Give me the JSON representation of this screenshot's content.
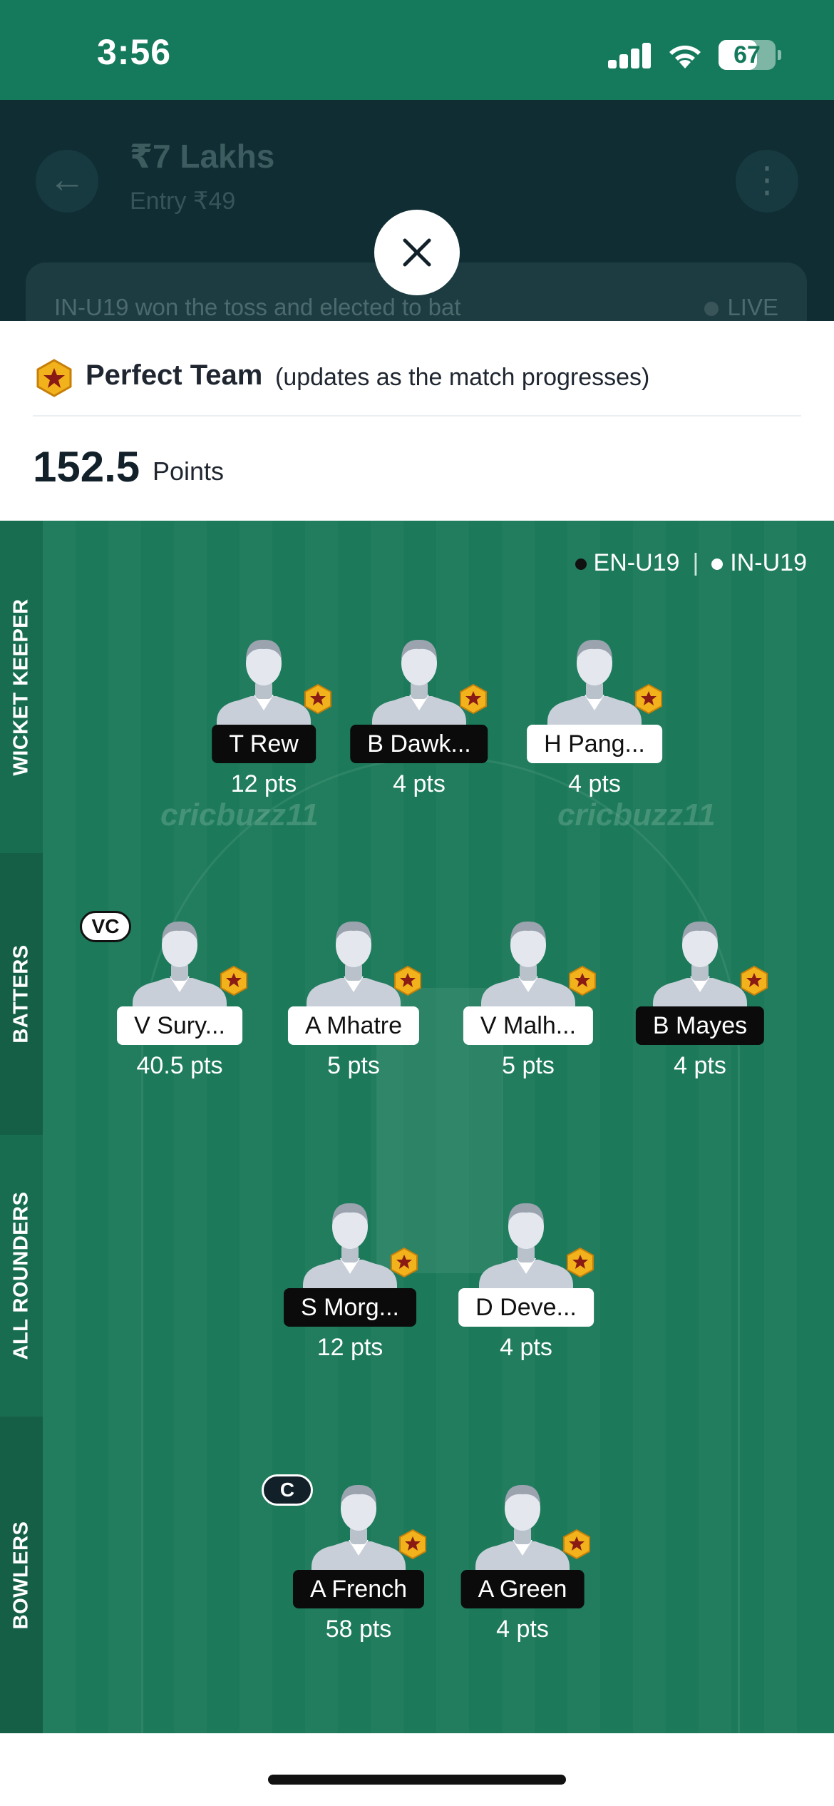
{
  "status_bar": {
    "time": "3:56",
    "battery": "67",
    "battery_level": 0.67
  },
  "background": {
    "title": "₹7 Lakhs",
    "entry": "Entry ₹49",
    "toss": "IN-U19 won the toss and elected to bat",
    "live": "LIVE"
  },
  "sheet": {
    "title": "Perfect Team",
    "subtitle": "(updates as the match progresses)",
    "points_value": "152.5",
    "points_label": "Points"
  },
  "legend": {
    "team1": "EN-U19",
    "separator": "|",
    "team2": "IN-U19",
    "team1_color": "#111111",
    "team2_color": "#ffffff"
  },
  "watermark": "cricbuzz11",
  "roles": {
    "wicket_keeper": "WICKET KEEPER",
    "batters": "BATTERS",
    "all_rounders": "ALL ROUNDERS",
    "bowlers": "BOWLERS"
  },
  "players": {
    "wk": [
      {
        "name": "T Rew",
        "pts": "12 pts",
        "team": "EN-U19"
      },
      {
        "name": "B Dawk...",
        "pts": "4 pts",
        "team": "EN-U19"
      },
      {
        "name": "H Pang...",
        "pts": "4 pts",
        "team": "IN-U19"
      }
    ],
    "bat": [
      {
        "name": "V Sury...",
        "pts": "40.5 pts",
        "team": "IN-U19",
        "badge": "VC"
      },
      {
        "name": "A Mhatre",
        "pts": "5 pts",
        "team": "IN-U19"
      },
      {
        "name": "V Malh...",
        "pts": "5 pts",
        "team": "IN-U19"
      },
      {
        "name": "B Mayes",
        "pts": "4 pts",
        "team": "EN-U19"
      }
    ],
    "ar": [
      {
        "name": "S Morg...",
        "pts": "12 pts",
        "team": "EN-U19"
      },
      {
        "name": "D Deve...",
        "pts": "4 pts",
        "team": "IN-U19"
      }
    ],
    "bowl": [
      {
        "name": "A French",
        "pts": "58 pts",
        "team": "EN-U19",
        "badge": "C"
      },
      {
        "name": "A Green",
        "pts": "4 pts",
        "team": "EN-U19"
      }
    ]
  },
  "icons": {
    "close": "close-icon",
    "star_badge": "star-badge-icon",
    "avatar": "player-avatar-icon"
  },
  "colors": {
    "brand": "#157a5c",
    "field": "#1c7a5a",
    "badge_gold": "#f2b21b"
  }
}
